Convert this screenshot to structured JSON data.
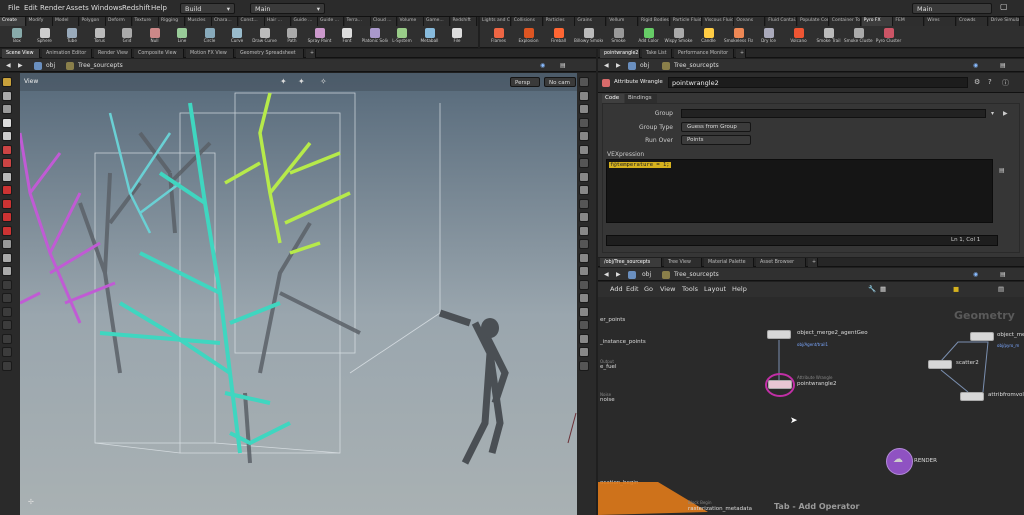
{
  "menubar": {
    "items": [
      "File",
      "Edit",
      "Render",
      "Assets",
      "Windows",
      "Redshift",
      "Help"
    ],
    "desktop": "Build",
    "stage": "Main",
    "right_desktop": "Main"
  },
  "shelf_tabs_left": [
    "Create",
    "Modify",
    "Model",
    "Polygon",
    "Deform",
    "Texture",
    "Rigging",
    "Muscles",
    "Chara...",
    "Const...",
    "Hair ...",
    "Guide ...",
    "Guide ...",
    "Terra...",
    "Cloud ...",
    "Volume",
    "Game...",
    "Redshift"
  ],
  "shelf_tabs_right": [
    "Lights and C...",
    "Collisions",
    "Particles",
    "Grains",
    "Vellum",
    "Rigid Bodies",
    "Particle Fluids",
    "Viscous Fluids",
    "Oceans",
    "Fluid Contai...",
    "Populate Con...",
    "Container Tools",
    "Pyro FX",
    "FEM",
    "Wires",
    "Crowds",
    "Drive Simula..."
  ],
  "shelf_tools_left": [
    "Box",
    "Sphere",
    "Tube",
    "Torus",
    "Grid",
    "Null",
    "Line",
    "Circle",
    "Curve",
    "Draw Curve",
    "Path",
    "Spray Paint",
    "Font",
    "Platonic Solids",
    "L-System",
    "Metaball",
    "File"
  ],
  "shelf_tools_right": [
    "Flames",
    "Explosion",
    "Fireball",
    "Billowy Smoke",
    "Smoke",
    "Add Color",
    "Wispy Smoke",
    "Candle",
    "Smokeless Flame",
    "Dry Ice",
    "Volcano",
    "Smoke Trail",
    "Smoke Cluster",
    "Pyro Cluster"
  ],
  "left_pane": {
    "tabs": [
      "Scene View",
      "Animation Editor",
      "Render View",
      "Composite View",
      "Motion FX View",
      "Geometry Spreadsheet"
    ],
    "path_root": "obj",
    "path_node": "Tree_sourcepts",
    "view_label": "View",
    "persp": "Persp",
    "cam": "No cam"
  },
  "right_top": {
    "tabs": [
      "pointwrangle2",
      "Take List",
      "Performance Monitor"
    ],
    "path_root": "obj",
    "path_node": "Tree_sourcepts",
    "node_type": "Attribute Wrangle",
    "node_name": "pointwrangle2",
    "parm_tabs": [
      "Code",
      "Bindings"
    ],
    "group_label": "Group",
    "group_type_label": "Group Type",
    "group_type_value": "Guess from Group",
    "run_over_label": "Run Over",
    "run_over_value": "Points",
    "vex_label": "VEXpression",
    "vex_code": "f@temperature = 1;",
    "status": "Ln 1, Col 1"
  },
  "right_bottom": {
    "tabs": [
      "/obj/Tree_sourcepts",
      "Tree View",
      "Material Palette",
      "Asset Browser"
    ],
    "path_root": "obj",
    "path_node": "Tree_sourcepts",
    "menu": [
      "Add",
      "Edit",
      "Go",
      "View",
      "Tools",
      "Layout",
      "Help"
    ],
    "context": "Geometry",
    "left_labels": [
      "er_points",
      "_instance_points",
      "e_fuel",
      "noise",
      "ocation_begin"
    ],
    "left_sublabels": [
      "",
      "",
      "Output",
      "Noise",
      ""
    ],
    "nodes": {
      "merge": "object_merge2_agentGeo",
      "merge_sub": "obj/Agent/trail1",
      "wrangle": "pointwrangle2",
      "wrangle_type": "Attribute Wrangle",
      "scatter": "scatter2",
      "attribfrom": "attribfromvol1",
      "objme": "object_me",
      "objme_sub": "obj/pyro_m",
      "render": "RENDER",
      "raster": "rasterization_metadata",
      "raster_type": "Block Begin"
    },
    "hint": "Tab - Add Operator"
  }
}
